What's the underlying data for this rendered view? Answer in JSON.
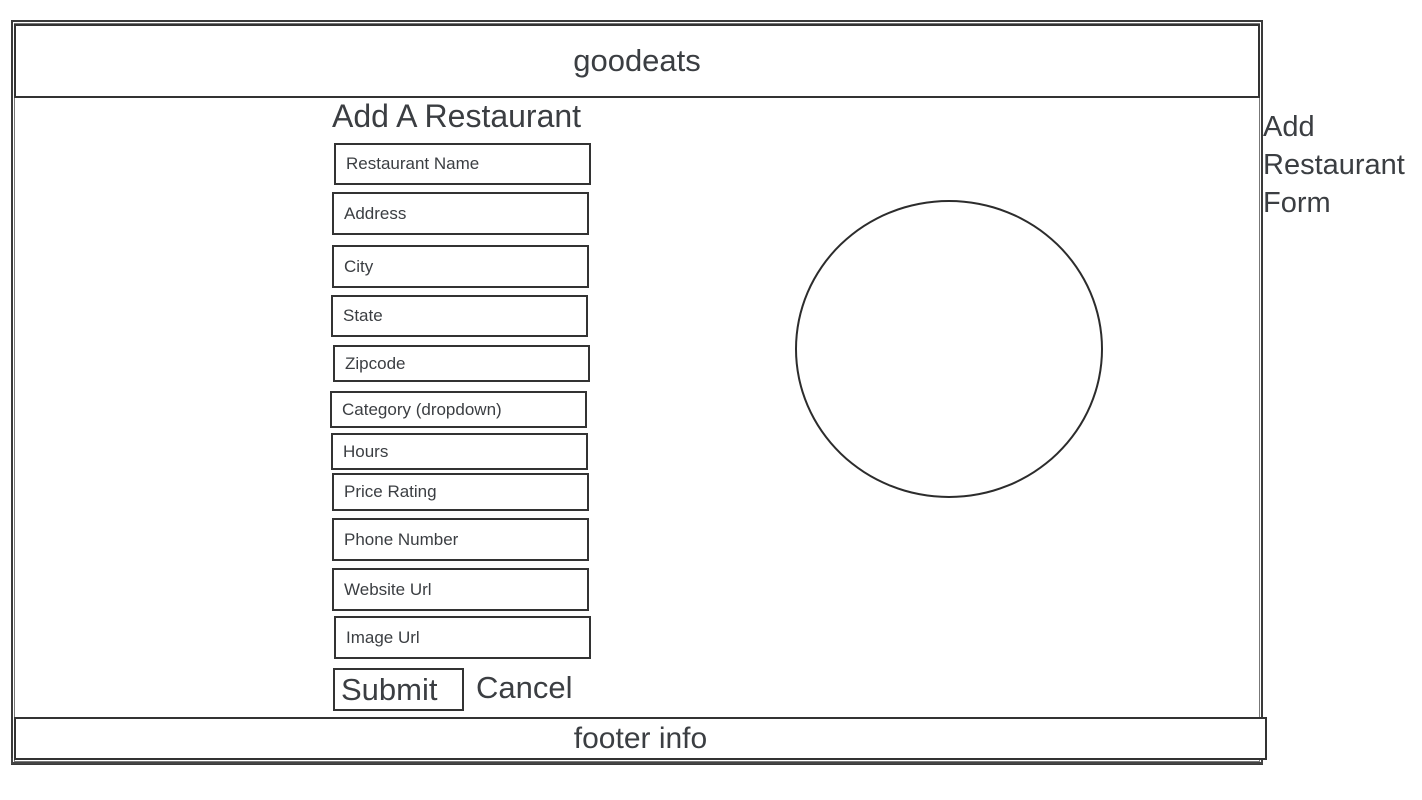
{
  "header": {
    "title": "goodeats"
  },
  "form": {
    "title": "Add A Restaurant",
    "fields": [
      {
        "placeholder": "Restaurant Name"
      },
      {
        "placeholder": "Address"
      },
      {
        "placeholder": "City"
      },
      {
        "placeholder": "State"
      },
      {
        "placeholder": "Zipcode"
      },
      {
        "placeholder": "Category (dropdown)"
      },
      {
        "placeholder": "Hours"
      },
      {
        "placeholder": "Price Rating"
      },
      {
        "placeholder": "Phone Number"
      },
      {
        "placeholder": "Website Url"
      },
      {
        "placeholder": "Image Url"
      }
    ],
    "submit_label": "Submit",
    "cancel_label": "Cancel"
  },
  "image_placeholder": {
    "shape": "circle"
  },
  "annotation": {
    "lines": [
      "Add",
      "Restaurant",
      "Form"
    ]
  },
  "footer": {
    "text": "footer info"
  }
}
